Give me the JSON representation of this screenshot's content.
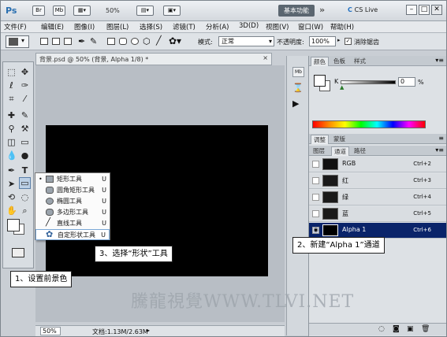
{
  "titlebar": {
    "logo": "Ps",
    "br": "Br",
    "mb": "Mb",
    "zoom": "50%",
    "workspace": "基本功能",
    "more": "»",
    "cslive": "CS Live",
    "minimize": "–",
    "restore": "□",
    "close": "✕"
  },
  "menubar": {
    "items": [
      "文件(F)",
      "编辑(E)",
      "图像(I)",
      "图层(L)",
      "选择(S)",
      "滤镜(T)",
      "分析(A)",
      "3D(D)",
      "视图(V)",
      "窗口(W)",
      "帮助(H)"
    ]
  },
  "options": {
    "mode_label": "模式:",
    "mode_value": "正常",
    "opacity_label": "不透明度:",
    "opacity_value": "100%",
    "antialias_label": "消除锯齿"
  },
  "document": {
    "tab_title": "背景.psd @ 50% (背景, Alpha 1/8) *",
    "zoom": "50%",
    "doc_info": "文档:1.13M/2.63M"
  },
  "color_panel": {
    "tabs": [
      "颜色",
      "色板",
      "样式"
    ],
    "channel_label": "K",
    "value": "0",
    "unit": "%"
  },
  "adjust_panel": {
    "tabs": [
      "调整",
      "蒙版"
    ]
  },
  "channels_panel": {
    "tabs": [
      "图层",
      "通道",
      "路径"
    ],
    "rows": [
      {
        "name": "RGB",
        "key": "Ctrl+2"
      },
      {
        "name": "红",
        "key": "Ctrl+3"
      },
      {
        "name": "绿",
        "key": "Ctrl+4"
      },
      {
        "name": "蓝",
        "key": "Ctrl+5"
      },
      {
        "name": "Alpha 1",
        "key": "Ctrl+6"
      }
    ]
  },
  "flyout": {
    "items": [
      {
        "label": "矩形工具",
        "key": "U"
      },
      {
        "label": "圆角矩形工具",
        "key": "U"
      },
      {
        "label": "椭圆工具",
        "key": "U"
      },
      {
        "label": "多边形工具",
        "key": "U"
      },
      {
        "label": "直线工具",
        "key": "U"
      },
      {
        "label": "自定形状工具",
        "key": "U"
      }
    ]
  },
  "callouts": {
    "step1": "1、设置前景色",
    "step2": "2、新建“Alpha 1”通道",
    "step3": "3、选择“形状”工具"
  },
  "watermark": "騰龍視覺WWW.TLVI.NET"
}
